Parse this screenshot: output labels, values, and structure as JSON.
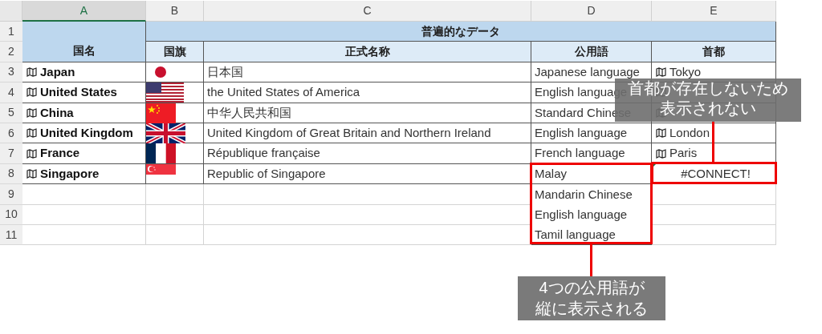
{
  "columns": [
    "A",
    "B",
    "C",
    "D",
    "E"
  ],
  "row_numbers": [
    "1",
    "2",
    "3",
    "4",
    "5",
    "6",
    "7",
    "8",
    "9",
    "10",
    "11"
  ],
  "group_header": "普遍的なデータ",
  "headers": [
    "国名",
    "国旗",
    "正式名称",
    "公用語",
    "首都"
  ],
  "countries": [
    {
      "name": "Japan",
      "kind": "japan",
      "official_name": "日本国",
      "languages": [
        "Japanese language"
      ],
      "capital": "Tokyo"
    },
    {
      "name": "United States",
      "kind": "usa",
      "official_name": "the United States of America",
      "languages": [
        "English language"
      ]
    },
    {
      "name": "China",
      "kind": "china",
      "official_name": "中华人民共和国",
      "languages": [
        "Standard Chinese"
      ]
    },
    {
      "name": "United Kingdom",
      "kind": "uk",
      "official_name": "United Kingdom of Great Britain and Northern Ireland",
      "languages": [
        "English language"
      ],
      "capital": "London"
    },
    {
      "name": "France",
      "kind": "france",
      "official_name": "République française",
      "languages": [
        "French language"
      ],
      "capital": "Paris"
    },
    {
      "name": "Singapore",
      "kind": "singapore",
      "official_name": "Republic of Singapore",
      "languages": [
        "Malay",
        "Mandarin Chinese",
        "English language",
        "Tamil language"
      ],
      "capital_error": "#CONNECT!"
    }
  ],
  "callouts": [
    {
      "lines": [
        "首都が存在しないため",
        "表示されない"
      ],
      "kind": "capital"
    },
    {
      "lines": [
        "4つの公用語が",
        "縦に表示される"
      ],
      "kind": "languages"
    }
  ]
}
